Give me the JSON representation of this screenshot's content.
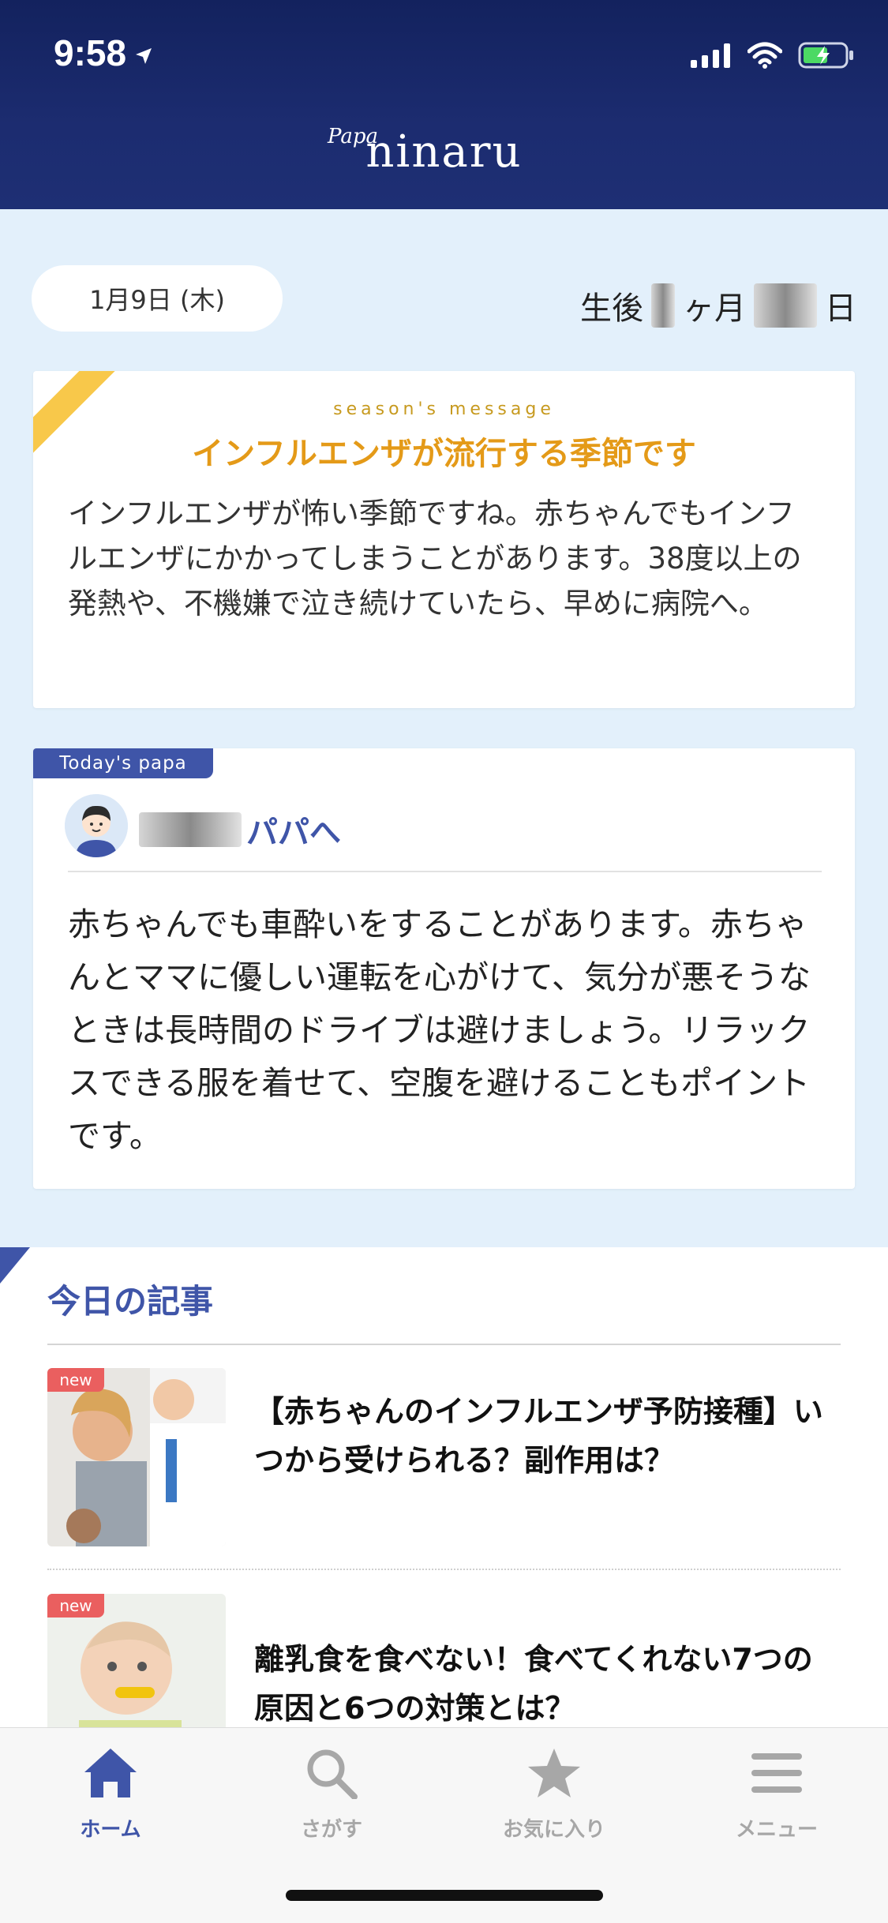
{
  "status_bar": {
    "time": "9:58"
  },
  "header": {
    "logo_small": "Papa",
    "logo": "ninaru"
  },
  "date_bar": {
    "date": "1月9日 (木)",
    "age_prefix": "生後",
    "age_month_suffix": "ヶ月",
    "age_day_suffix": "日"
  },
  "season": {
    "sub": "season's message",
    "title": "インフルエンザが流行する季節です",
    "body": "インフルエンザが怖い季節ですね。赤ちゃんでもインフルエンザにかかってしまうことがあります。38度以上の発熱や、不機嫌で泣き続けていたら、早めに病院へ。"
  },
  "papa": {
    "tag": "Today's papa",
    "name_suffix": "パパへ",
    "body": "赤ちゃんでも車酔いをすることがあります。赤ちゃんとママに優しい運転を心がけて、気分が悪そうなときは長時間のドライブは避けましょう。リラックスできる服を着せて、空腹を避けることもポイントです。"
  },
  "articles": {
    "heading": "今日の記事",
    "items": [
      {
        "badge": "new",
        "title": "【赤ちゃんのインフルエンザ予防接種】いつから受けられる？副作用は？"
      },
      {
        "badge": "new",
        "title": "離乳食を食べない！食べてくれない7つの原因と6つの対策とは？"
      }
    ]
  },
  "tabbar": {
    "active_color": "#3f55a8",
    "inactive_color": "#a7a7a7",
    "items": [
      {
        "label": "ホーム",
        "icon": "home-icon",
        "active": true
      },
      {
        "label": "さがす",
        "icon": "search-icon",
        "active": false
      },
      {
        "label": "お気に入り",
        "icon": "star-icon",
        "active": false
      },
      {
        "label": "メニュー",
        "icon": "menu-icon",
        "active": false
      }
    ]
  },
  "colors": {
    "header": "#1c2c70",
    "background": "#e3f0fb",
    "accent": "#3f55a8",
    "season_title": "#e49a18",
    "new_badge": "#ea5f5f"
  }
}
